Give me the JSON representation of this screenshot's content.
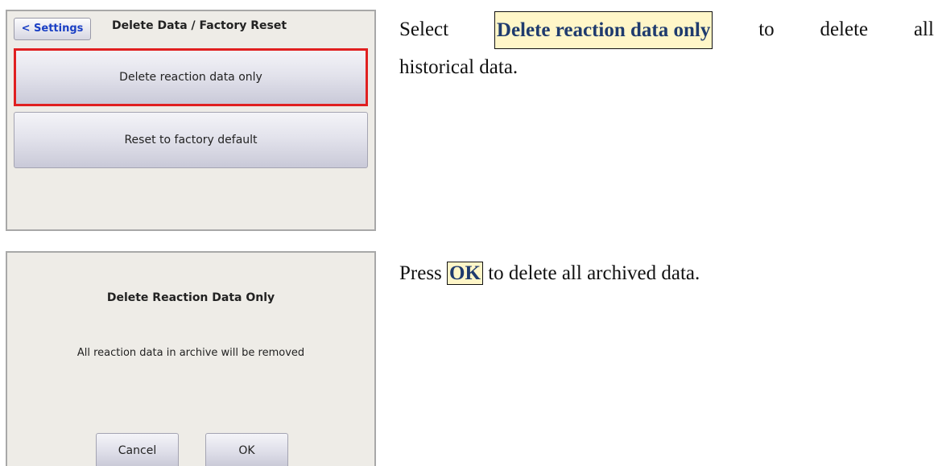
{
  "screen1": {
    "back_button": "< Settings",
    "title": "Delete Data / Factory Reset",
    "buttons": {
      "delete_reaction": "Delete reaction data only",
      "reset_factory": "Reset to factory default"
    }
  },
  "instruction1": {
    "w1": "Select",
    "keyword": "Delete reaction data only",
    "w3": "to",
    "w4": "delete",
    "w5": "all",
    "line2": "historical data."
  },
  "screen2": {
    "dialog_title": "Delete Reaction Data Only",
    "message": "All reaction data in archive will be removed",
    "cancel": "Cancel",
    "ok": "OK"
  },
  "instruction2": {
    "pre": "Press",
    "keyword": "OK",
    "post": "to delete all archived data."
  },
  "colors": {
    "highlight": "#e02020",
    "back_text": "#1a3fc4",
    "keyword_text": "#1f3b6e",
    "keyword_bg": "#fff6c8"
  }
}
